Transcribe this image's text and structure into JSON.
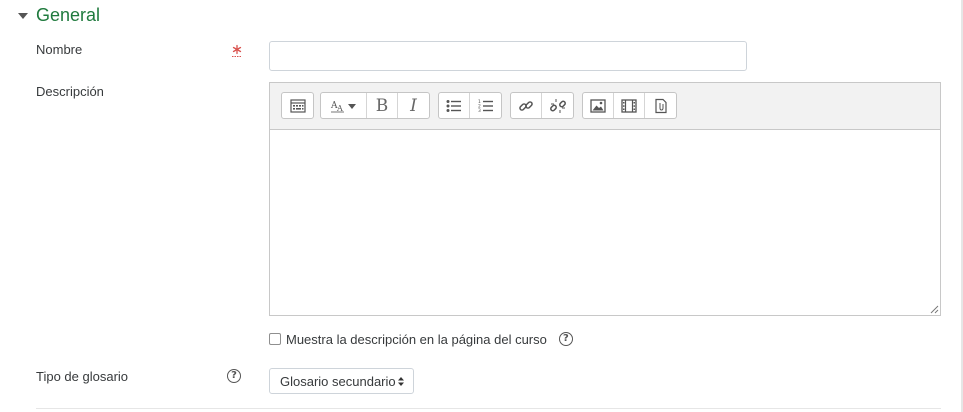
{
  "section": {
    "title": "General",
    "icon": "caret-down-icon"
  },
  "fields": {
    "nombre": {
      "label": "Nombre",
      "value": "",
      "required": true,
      "required_icon": "required-asterisk-icon"
    },
    "descripcion": {
      "label": "Descripción"
    },
    "tipo": {
      "label": "Tipo de glosario",
      "selected": "Glosario secundario"
    }
  },
  "toolbar": {
    "groups": [
      [
        "toolbar-toggle-icon"
      ],
      [
        "font-style-icon",
        "bold-icon",
        "italic-icon"
      ],
      [
        "unordered-list-icon",
        "ordered-list-icon"
      ],
      [
        "link-icon",
        "unlink-icon"
      ],
      [
        "image-icon",
        "media-icon",
        "file-icon"
      ]
    ],
    "bold_glyph": "B",
    "italic_glyph": "I"
  },
  "checkbox": {
    "label": "Muestra la descripción en la página del curso",
    "checked": false
  },
  "colors": {
    "accent": "#1f7a3d",
    "required": "#d9534f"
  }
}
